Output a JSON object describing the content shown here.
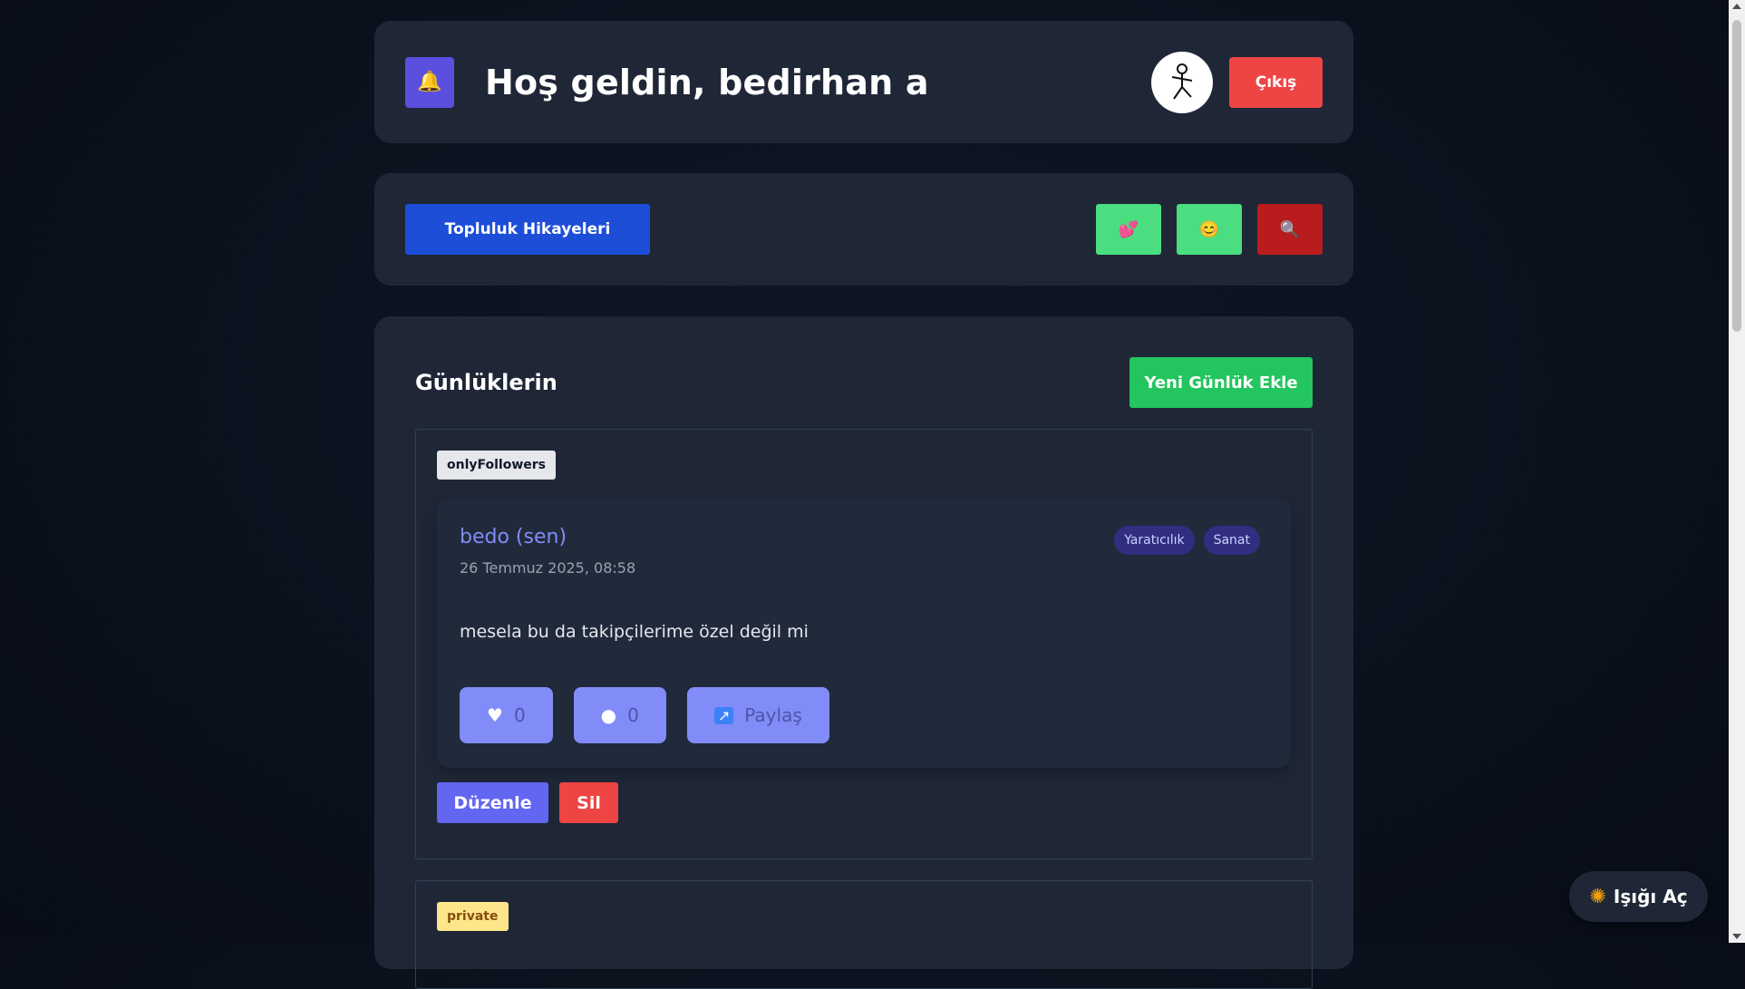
{
  "header": {
    "bell_icon": "bell-icon",
    "welcome": "Hoş geldin, bedirhan a",
    "logout_label": "Çıkış"
  },
  "nav": {
    "stories_label": "Topluluk Hikayeleri",
    "icons": [
      "hearts-icon",
      "smiley-icon",
      "search-icon"
    ],
    "icon_glyphs": [
      "💕",
      "😊",
      "🔍"
    ]
  },
  "main": {
    "title": "Günlüklerin",
    "new_entry_label": "Yeni Günlük Ekle"
  },
  "entries": [
    {
      "visibility": "onlyFollowers",
      "author": "bedo (sen)",
      "date": "26 Temmuz 2025, 08:58",
      "tags": [
        "Yaratıcılık",
        "Sanat"
      ],
      "content": "mesela bu da takipçilerime özel değil mi",
      "likes": "0",
      "comments": "0",
      "share_label": "Paylaş",
      "edit_label": "Düzenle",
      "delete_label": "Sil"
    },
    {
      "visibility": "private"
    }
  ],
  "theme_toggle": {
    "label": "Işığı Aç",
    "icon": "sun-icon"
  },
  "colors": {
    "background": "#0b111d",
    "card": "#1f2737",
    "accent_indigo": "#818cf8",
    "logout_red": "#ef4444",
    "stories_blue": "#1d4ed8",
    "new_entry_green": "#22c55e"
  }
}
